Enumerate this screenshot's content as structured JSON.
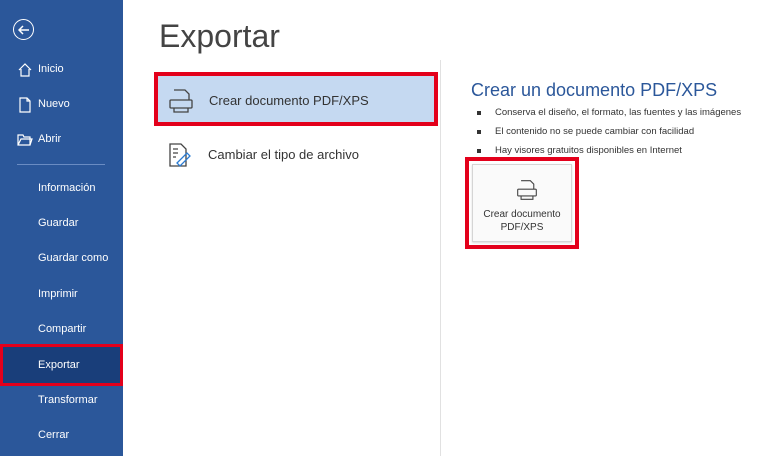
{
  "sidebar": {
    "items": [
      {
        "label": "Inicio"
      },
      {
        "label": "Nuevo"
      },
      {
        "label": "Abrir"
      },
      {
        "label": "Información"
      },
      {
        "label": "Guardar"
      },
      {
        "label": "Guardar como"
      },
      {
        "label": "Imprimir"
      },
      {
        "label": "Compartir"
      },
      {
        "label": "Exportar"
      },
      {
        "label": "Transformar"
      },
      {
        "label": "Cerrar"
      }
    ],
    "selected": "Exportar"
  },
  "main": {
    "title": "Exportar",
    "options": [
      {
        "label": "Crear documento PDF/XPS",
        "icon": "pdf-document-icon"
      },
      {
        "label": "Cambiar el tipo de archivo",
        "icon": "change-file-type-icon"
      }
    ]
  },
  "panel": {
    "title": "Crear un documento PDF/XPS",
    "bullets": [
      "Conserva el diseño, el formato, las fuentes y las imágenes",
      "El contenido no se puede cambiar con facilidad",
      "Hay visores gratuitos disponibles en Internet"
    ],
    "button_label": "Crear documento\nPDF/XPS"
  },
  "colors": {
    "sidebar": "#2b579a",
    "selected": "#193e7a",
    "highlight": "#e3001b",
    "option_selected": "#c5d9f1"
  }
}
